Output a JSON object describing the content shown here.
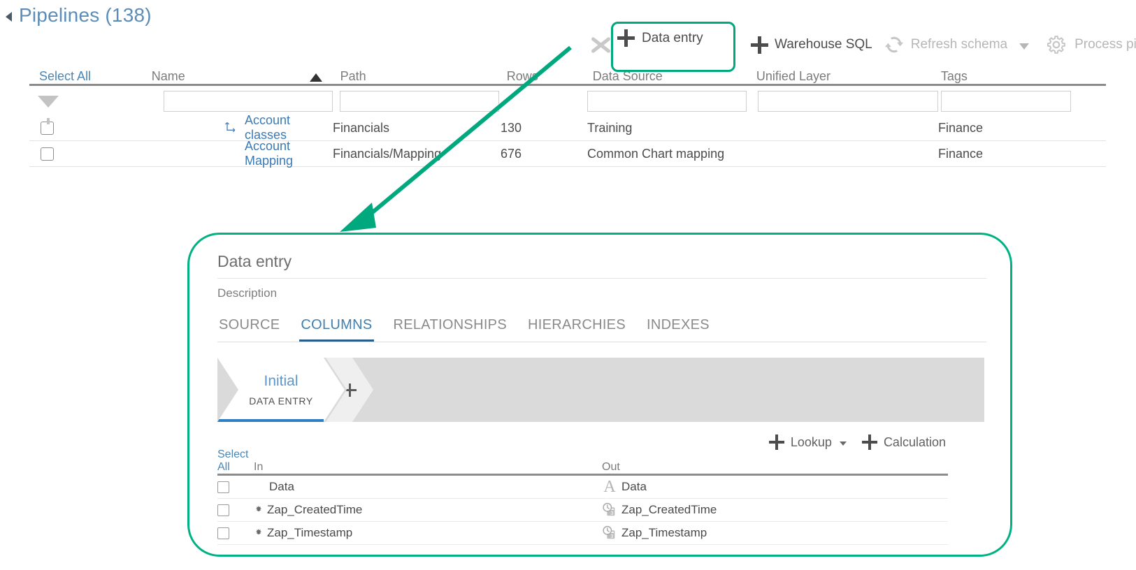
{
  "header": {
    "title": "Pipelines (138)",
    "caret_icon": "collapse-caret-icon"
  },
  "toolbar": {
    "close_icon": "close-x-icon",
    "items": [
      {
        "label": "Data entry",
        "icon": "plus-icon",
        "state": "highlighted"
      },
      {
        "label": "Warehouse SQL",
        "icon": "plus-icon",
        "state": "enabled"
      },
      {
        "label": "Refresh schema",
        "icon": "refresh-icon",
        "state": "disabled",
        "has_dropdown": true
      },
      {
        "label": "Process pipe",
        "icon": "gear-icon",
        "state": "disabled"
      }
    ],
    "highlight_color": "#00a87e"
  },
  "grid": {
    "select_all_label": "Select All",
    "columns": [
      {
        "key": "select",
        "label": "Select All"
      },
      {
        "key": "name",
        "label": "Name",
        "sorted": "asc"
      },
      {
        "key": "path",
        "label": "Path"
      },
      {
        "key": "rows",
        "label": "Rows"
      },
      {
        "key": "source",
        "label": "Data Source"
      },
      {
        "key": "unified",
        "label": "Unified Layer"
      },
      {
        "key": "tags",
        "label": "Tags"
      }
    ],
    "filter_row": {
      "funnel_icon": "filter-funnel-icon",
      "name_value": "",
      "path_value": "",
      "source_value": "",
      "unified_value": "",
      "tags_value": ""
    },
    "rows": [
      {
        "name": "Account classes",
        "path": "Financials",
        "rows": "130",
        "source": "Training",
        "unified": "",
        "tags": "Finance",
        "has_lineage_icon": true
      },
      {
        "name": "Account Mapping",
        "path": "Financials/Mapping",
        "rows": "676",
        "source": "Common Chart mapping",
        "unified": "",
        "tags": "Finance",
        "has_lineage_icon": false
      }
    ]
  },
  "annotation": {
    "color": "#00a87e",
    "shape": "arrow-pointing-down-left"
  },
  "detail_panel": {
    "border_color": "#00b283",
    "title": "Data entry",
    "description_label": "Description",
    "tabs": [
      {
        "label": "SOURCE",
        "active": false
      },
      {
        "label": "COLUMNS",
        "active": true
      },
      {
        "label": "RELATIONSHIPS",
        "active": false
      },
      {
        "label": "HIERARCHIES",
        "active": false
      },
      {
        "label": "INDEXES",
        "active": false
      }
    ],
    "stages": [
      {
        "name": "Initial",
        "type": "DATA ENTRY",
        "active": true
      },
      {
        "name": "",
        "type": "",
        "add": true,
        "icon": "plus-icon"
      }
    ],
    "column_actions": [
      {
        "label": "Lookup",
        "icon": "plus-icon",
        "has_dropdown": true
      },
      {
        "label": "Calculation",
        "icon": "plus-icon",
        "has_dropdown": false
      }
    ],
    "columns_table": {
      "select_all_label": "Select All",
      "headers": [
        {
          "key": "select",
          "label": "Select All"
        },
        {
          "key": "in",
          "label": "In"
        },
        {
          "key": "out",
          "label": "Out"
        }
      ],
      "rows": [
        {
          "in": "Data",
          "in_icon": "",
          "out": "Data",
          "out_icon": "text-type-icon"
        },
        {
          "in": "Zap_CreatedTime",
          "in_icon": "gear-icon",
          "out": "Zap_CreatedTime",
          "out_icon": "datetime-type-icon"
        },
        {
          "in": "Zap_Timestamp",
          "in_icon": "gear-icon",
          "out": "Zap_Timestamp",
          "out_icon": "datetime-type-icon"
        }
      ]
    }
  }
}
